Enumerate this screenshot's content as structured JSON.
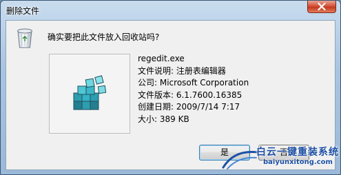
{
  "window": {
    "title": "删除文件"
  },
  "dialog": {
    "prompt": "确实要把此文件放入回收站吗?",
    "file": {
      "name": "regedit.exe",
      "description": "文件说明: 注册表编辑器",
      "company": "公司: Microsoft Corporation",
      "version": "文件版本: 6.1.7600.16385",
      "created": "创建日期: 2009/7/14 7:17",
      "size": "大小: 389 KB"
    },
    "buttons": {
      "yes": "是",
      "no": "否"
    }
  },
  "watermark": {
    "title": "白云一键重装系统",
    "url": "baiyunxitong.com"
  },
  "colors": {
    "accent": "#1c4fa3",
    "close": "#c33a1f"
  },
  "icons": [
    "close-icon",
    "recycle-bin-icon",
    "regedit-icon",
    "watermark-logo"
  ]
}
